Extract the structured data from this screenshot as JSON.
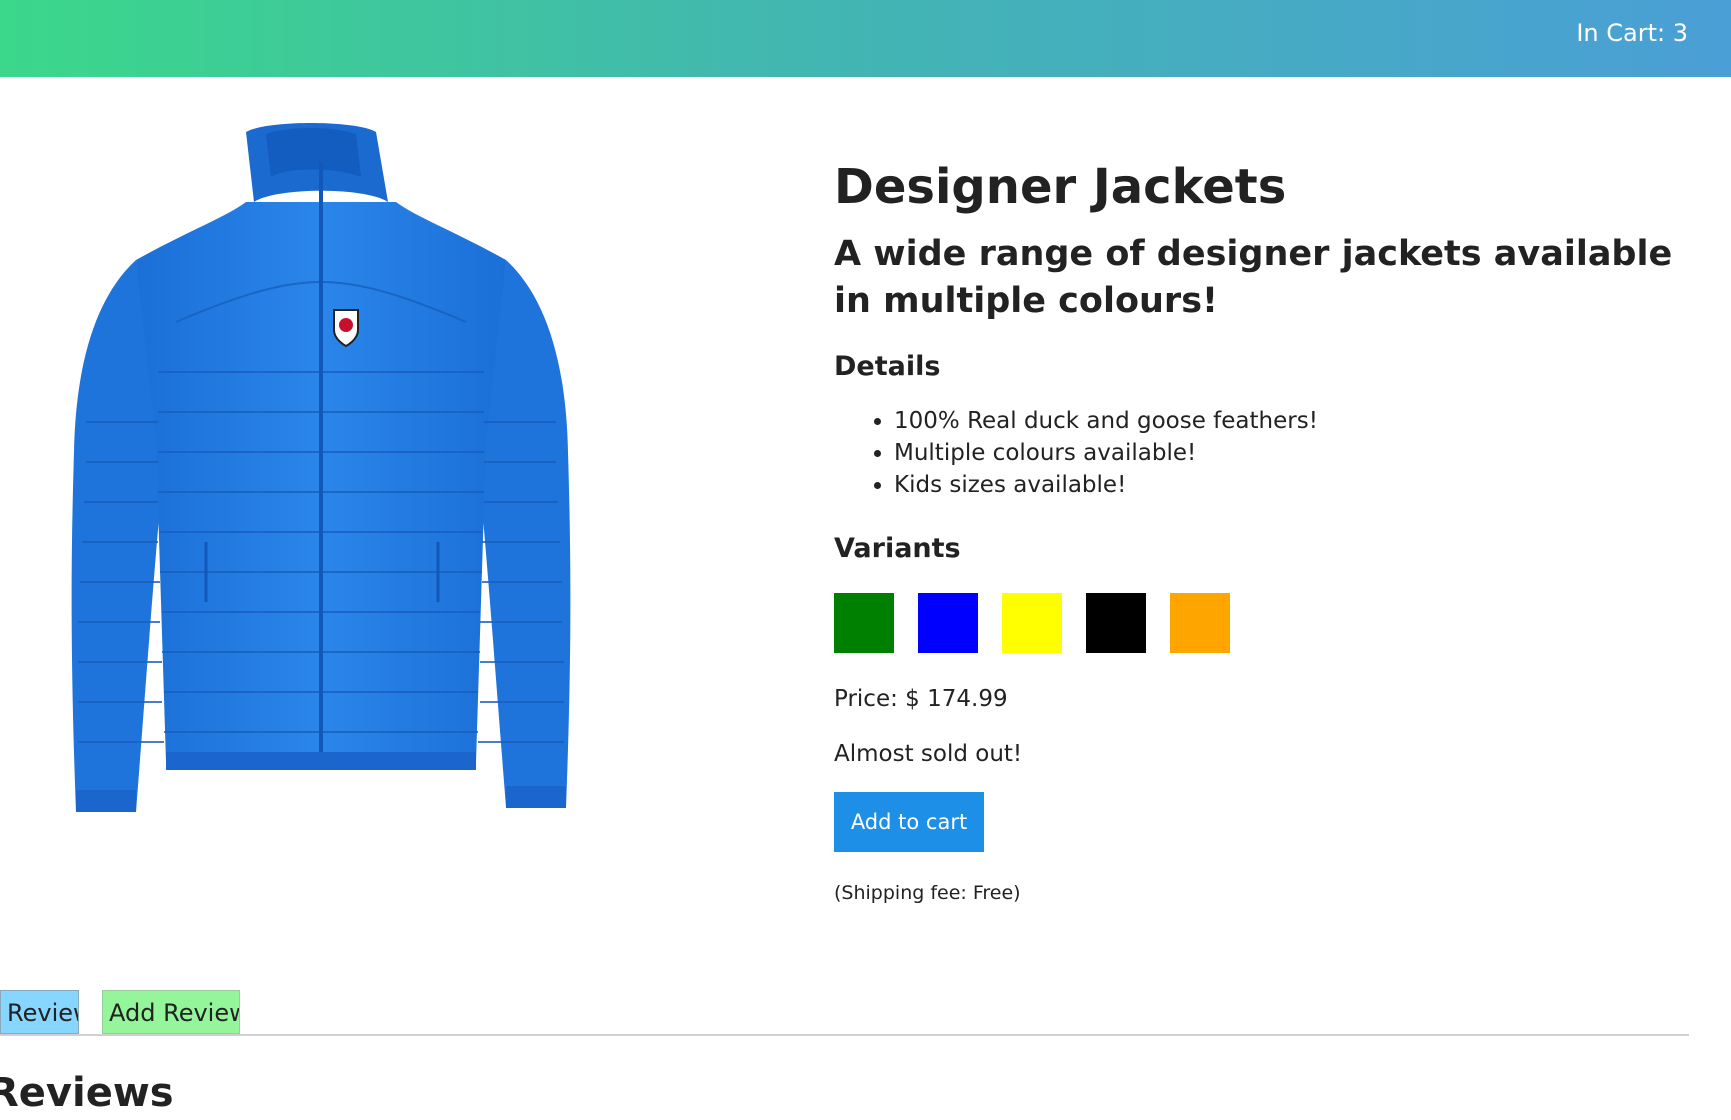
{
  "header": {
    "cart_label": "In Cart: 3"
  },
  "product": {
    "title": "Designer Jackets",
    "subtitle": "A wide range of designer jackets available in multiple colours!",
    "details_heading": "Details",
    "details": [
      "100% Real duck and goose feathers!",
      "Multiple colours available!",
      "Kids sizes available!"
    ],
    "variants_heading": "Variants",
    "variants": [
      {
        "color": "#008000"
      },
      {
        "color": "#0000ff"
      },
      {
        "color": "#ffff00"
      },
      {
        "color": "#000000"
      },
      {
        "color": "#ffa500"
      }
    ],
    "price": "Price: $ 174.99",
    "stock_status": "Almost sold out!",
    "add_to_cart_label": "Add to cart",
    "shipping": "(Shipping fee: Free)",
    "image_color": "#1e78e0"
  },
  "tabs": {
    "reviews_label": "Reviews",
    "add_review_label": "Add Review"
  },
  "reviews": {
    "heading": "Reviews"
  }
}
